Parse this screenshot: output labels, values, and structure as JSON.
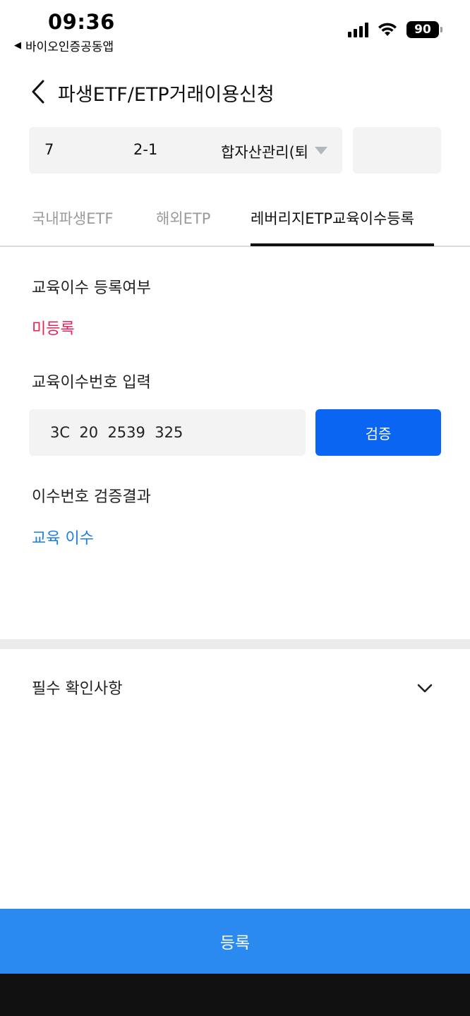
{
  "status_bar": {
    "time": "09:36",
    "back_app": "바이오인증공동앱",
    "back_app_arrow": "◀",
    "battery": "90",
    "icons": [
      "signal-icon",
      "wifi-icon",
      "battery-icon"
    ]
  },
  "header": {
    "title": "파생ETF/ETP거래이용신청",
    "back_icon": "chevron-left-icon"
  },
  "account": {
    "number_part1": "7",
    "number_part2": "2-1",
    "name": "합자산관리(퇴",
    "caret_icon": "caret-down-icon"
  },
  "tabs": [
    {
      "label": "국내파생ETF",
      "active": false
    },
    {
      "label": "해외ETP",
      "active": false
    },
    {
      "label": "레버리지ETP교육이수등록",
      "active": true
    }
  ],
  "education": {
    "status_label": "교육이수 등록여부",
    "status_value": "미등록",
    "number_label": "교육이수번호 입력",
    "number_value": "3C  20  2539  325",
    "verify_label": "검증",
    "result_label": "이수번호 검증결과",
    "result_value": "교육 이수"
  },
  "required": {
    "label": "필수 확인사항",
    "icon": "chevron-down-icon"
  },
  "footer": {
    "register_label": "등록"
  },
  "colors": {
    "primary_blue": "#0a66f2",
    "register_blue": "#2a8af0",
    "status_red": "#e2245b",
    "result_blue": "#1f7fe0"
  }
}
